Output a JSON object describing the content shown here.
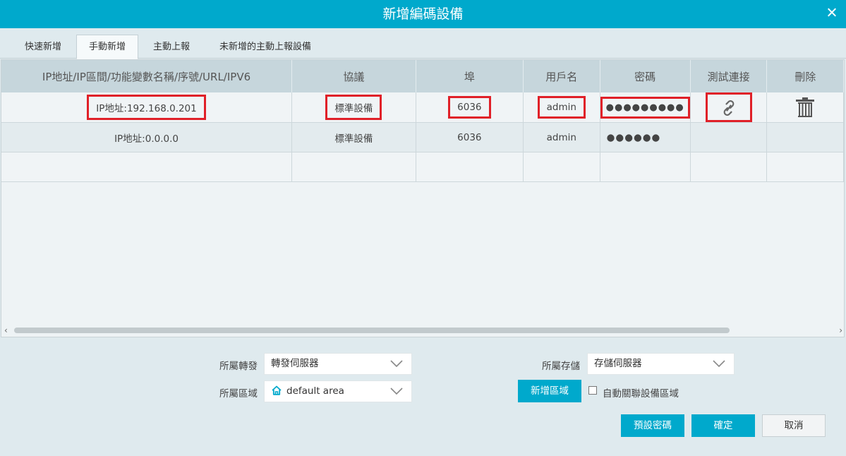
{
  "window": {
    "title": "新增編碼設備"
  },
  "tabs": [
    {
      "label": "快速新增"
    },
    {
      "label": "手動新增"
    },
    {
      "label": "主動上報"
    },
    {
      "label": "未新增的主動上報設備"
    }
  ],
  "table": {
    "columns": [
      "IP地址/IP區間/功能變數名稱/序號/URL/IPV6",
      "協議",
      "埠",
      "用戶名",
      "密碼",
      "測試連接",
      "刪除"
    ],
    "rows": [
      {
        "address": "IP地址:192.168.0.201",
        "protocol": "標準設備",
        "port": "6036",
        "username": "admin",
        "password": "●●●●●●●●●"
      },
      {
        "address": "IP地址:0.0.0.0",
        "protocol": "標準設備",
        "port": "6036",
        "username": "admin",
        "password": "●●●●●●"
      }
    ]
  },
  "form": {
    "forward_label": "所屬轉發",
    "forward_value": "轉發伺服器",
    "storage_label": "所屬存儲",
    "storage_value": "存儲伺服器",
    "area_label": "所屬區域",
    "area_value": "default area",
    "add_area_button": "新增區域",
    "auto_link_label": "自動關聯設備區域"
  },
  "footer": {
    "default_password_button": "預設密碼",
    "confirm_button": "確定",
    "cancel_button": "取消"
  },
  "colors": {
    "accent": "#00a9cc",
    "highlight": "#e02028"
  },
  "icons": [
    "close-icon",
    "link-icon",
    "trash-icon",
    "chevron-down-icon",
    "home-icon",
    "chevron-left-icon",
    "chevron-right-icon"
  ]
}
